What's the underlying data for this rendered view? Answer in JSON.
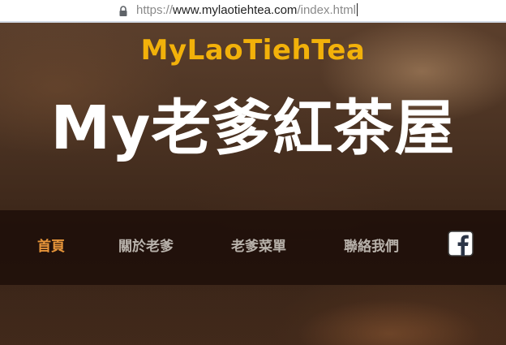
{
  "browser": {
    "url_scheme": "https://",
    "url_host": "www.mylaotiehtea.com",
    "url_path": "/index.html"
  },
  "hero": {
    "brand": "MyLaoTiehTea",
    "title": "My老爹紅茶屋"
  },
  "nav": {
    "items": [
      {
        "label": "首頁",
        "active": true
      },
      {
        "label": "關於老爹",
        "active": false
      },
      {
        "label": "老爹菜單",
        "active": false
      },
      {
        "label": "聯絡我們",
        "active": false
      }
    ],
    "social_icon": "facebook-icon"
  },
  "colors": {
    "brand": "#f2b10a",
    "nav_active": "#e8963a",
    "nav_text": "#b8b2ab",
    "nav_bg": "#1c0e08"
  }
}
